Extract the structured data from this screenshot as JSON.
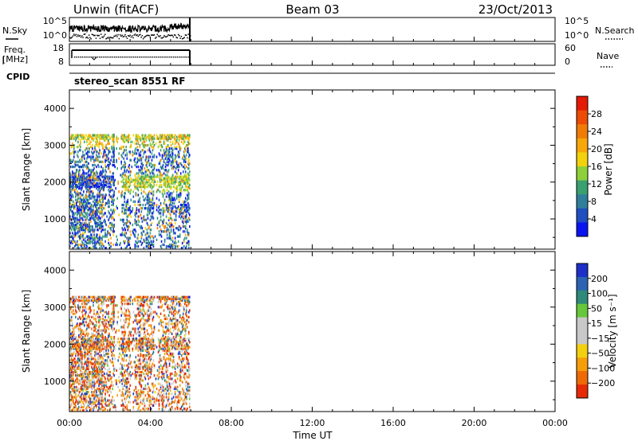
{
  "header": {
    "station": "Unwin (fitACF)",
    "beam": "Beam 03",
    "date": "23/Oct/2013"
  },
  "nsky_panel": {
    "left_label": "N.Sky",
    "right_label": "N.Search",
    "left_ticks": [
      "10^5",
      "10^0"
    ],
    "right_ticks": [
      "10^5",
      "10^0"
    ]
  },
  "freq_panel": {
    "left_label_line1": "Freq.",
    "left_label_line2": "[MHz]",
    "right_label": "Nave",
    "left_ticks": [
      "18",
      "8"
    ],
    "right_ticks": [
      "60",
      "0"
    ]
  },
  "cpid": {
    "label": "CPID",
    "value": "stereo_scan 8551 RF"
  },
  "chart_data": [
    {
      "type": "heatmap",
      "name": "power-panel",
      "ylabel": "Slant Range [km]",
      "ylim": [
        180,
        4500
      ],
      "y_ticks": [
        "1000",
        "2000",
        "3000",
        "4000"
      ],
      "x_range_hours": [
        0,
        24
      ],
      "data_coverage_hours": [
        0,
        5.95
      ],
      "data_range_km": [
        200,
        3300
      ],
      "colorbar": {
        "label": "Power [dB]",
        "tick_labels": [
          "4",
          "8",
          "12",
          "16",
          "20",
          "24",
          "28"
        ],
        "colors": [
          "#0a14f0",
          "#1e4ec0",
          "#2f7f9a",
          "#3aa070",
          "#8fd03a",
          "#f2d20c",
          "#f7a70a",
          "#f07c08",
          "#ec4c06",
          "#e41a04"
        ]
      }
    },
    {
      "type": "heatmap",
      "name": "velocity-panel",
      "ylabel": "Slant Range [km]",
      "ylim": [
        180,
        4500
      ],
      "y_ticks": [
        "1000",
        "2000",
        "3000",
        "4000"
      ],
      "x_range_hours": [
        0,
        24
      ],
      "data_coverage_hours": [
        0,
        5.95
      ],
      "data_range_km": [
        200,
        3300
      ],
      "colorbar": {
        "label": "Velocity [m s⁻¹]",
        "tick_labels": [
          "200",
          "100",
          "50",
          "15",
          "−15",
          "−50",
          "−100",
          "−200"
        ],
        "colors": [
          "#1d2fc8",
          "#2c63b2",
          "#2f8a7a",
          "#66c73a",
          "#c8c8c8",
          "#c8c8c8",
          "#f3d00f",
          "#f59e0a",
          "#ee6a07",
          "#e52a05"
        ]
      }
    }
  ],
  "time_axis": {
    "label": "Time UT",
    "ticks": [
      "00:00",
      "04:00",
      "08:00",
      "12:00",
      "16:00",
      "20:00",
      "00:00"
    ]
  }
}
